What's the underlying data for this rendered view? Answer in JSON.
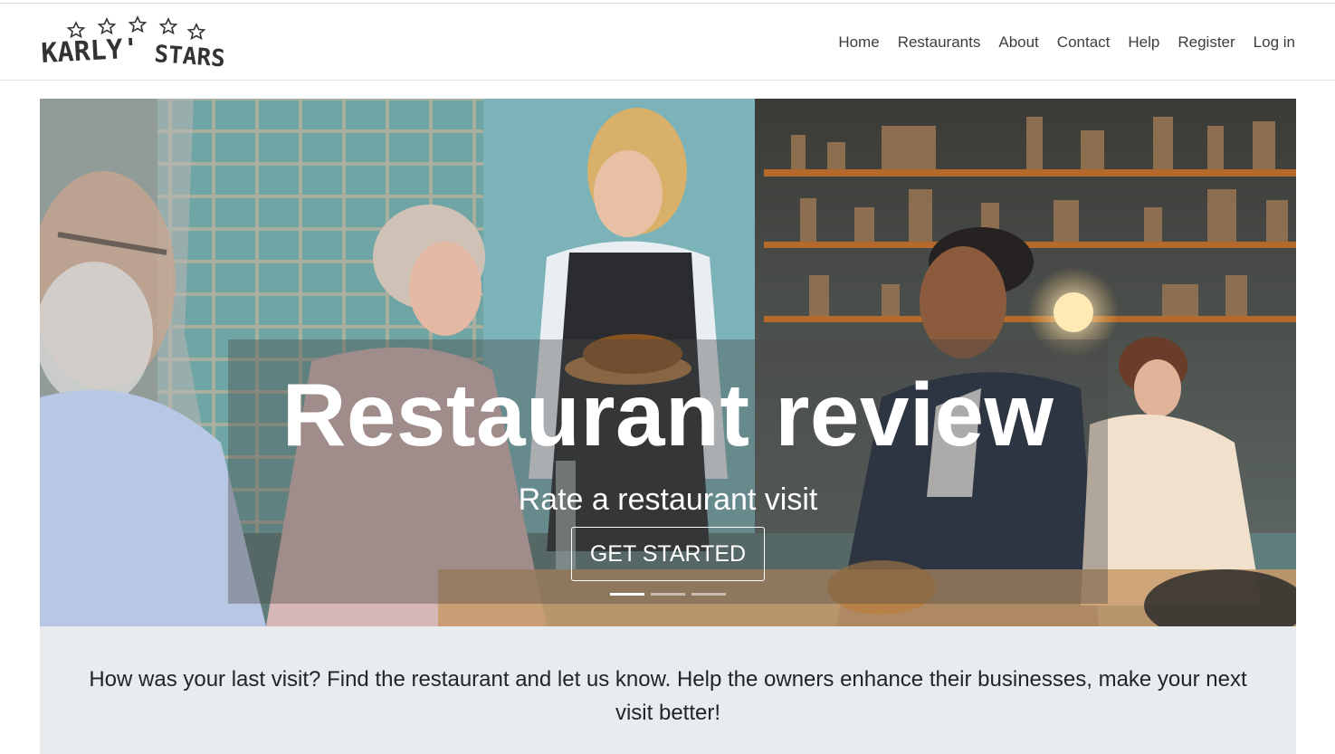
{
  "brand": {
    "name": "KARLY'STARS",
    "word1": "KARLY'",
    "word2": "STARS",
    "icon": "five-star-logo"
  },
  "nav": {
    "items": [
      {
        "label": "Home"
      },
      {
        "label": "Restaurants"
      },
      {
        "label": "About"
      },
      {
        "label": "Contact"
      },
      {
        "label": "Help"
      },
      {
        "label": "Register"
      },
      {
        "label": "Log in"
      }
    ]
  },
  "hero": {
    "title": "Restaurant review",
    "subtitle": "Rate a restaurant visit",
    "button_label": "GET STARTED",
    "carousel": {
      "slide_count": 3,
      "active_slide": 1
    }
  },
  "intro": {
    "text": "How was your last visit? Find the restaurant and let us know. Help the owners enhance their businesses, make your next visit better!"
  },
  "colors": {
    "intro_bg": "#e9ecef",
    "nav_text": "#3d3d3d",
    "hero_text": "#ffffff"
  }
}
